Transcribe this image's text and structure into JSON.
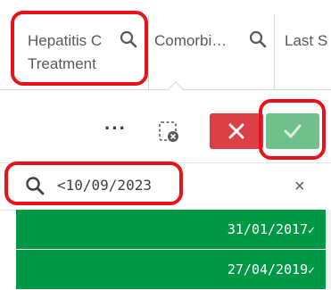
{
  "columns": [
    {
      "title_line1": "Hepatitis C",
      "title_line2": "Treatment",
      "search_icon": "search-icon"
    },
    {
      "title_line1": "Comorbi…",
      "search_icon": "search-icon"
    },
    {
      "title_line1": "Last S"
    }
  ],
  "toolbar": {
    "more_label": "···",
    "clear_selections_icon": "clear-selections-icon",
    "cancel_icon": "close-icon",
    "confirm_icon": "check-icon",
    "cancel_color": "#dc3f46",
    "confirm_color": "#6fc08a"
  },
  "search": {
    "value": "<10/09/2023",
    "icon": "search-icon",
    "clear_label": "×"
  },
  "list_items": [
    {
      "value": "31/01/2017",
      "check": "✓",
      "state": "selected"
    },
    {
      "value": "27/04/2019",
      "check": "✓",
      "state": "selected"
    }
  ],
  "colors": {
    "selected": "#009845",
    "annotation": "#e8121a"
  }
}
